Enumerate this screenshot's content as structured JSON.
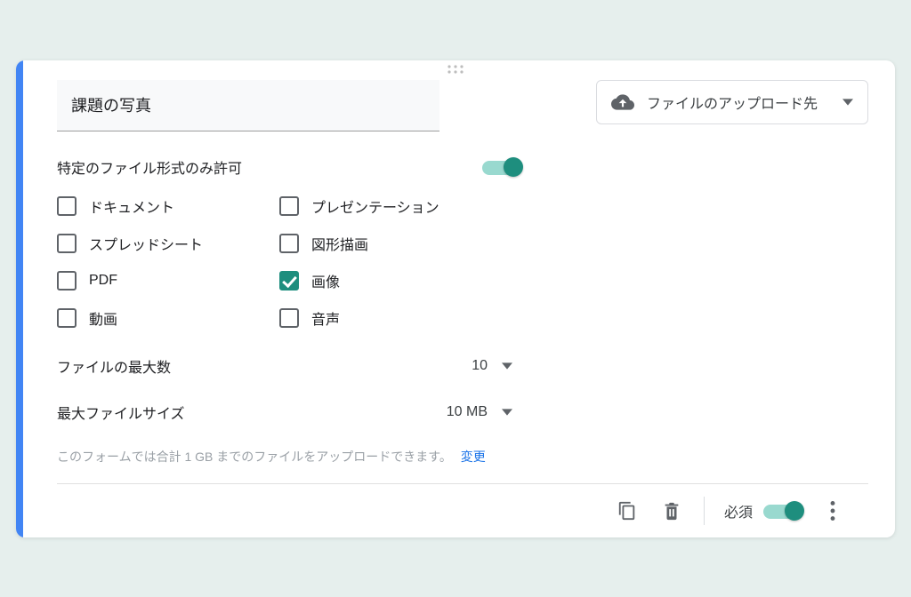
{
  "question": {
    "title": "課題の写真",
    "upload_destination_label": "ファイルのアップロード先"
  },
  "options": {
    "allow_specific_types_label": "特定のファイル形式のみ許可",
    "allow_specific_types_on": true,
    "types": {
      "document": {
        "label": "ドキュメント",
        "checked": false
      },
      "presentation": {
        "label": "プレゼンテーション",
        "checked": false
      },
      "spreadsheet": {
        "label": "スプレッドシート",
        "checked": false
      },
      "drawing": {
        "label": "図形描画",
        "checked": false
      },
      "pdf": {
        "label": "PDF",
        "checked": false
      },
      "image": {
        "label": "画像",
        "checked": true
      },
      "video": {
        "label": "動画",
        "checked": false
      },
      "audio": {
        "label": "音声",
        "checked": false
      }
    },
    "max_files_label": "ファイルの最大数",
    "max_files_value": "10",
    "max_size_label": "最大ファイルサイズ",
    "max_size_value": "10 MB"
  },
  "hint": {
    "text": "このフォームでは合計 1 GB までのファイルをアップロードできます。",
    "change": "変更"
  },
  "footer": {
    "required_label": "必須",
    "required_on": true
  },
  "colors": {
    "accent": "#4285f4",
    "teal": "#1e8e7e"
  }
}
